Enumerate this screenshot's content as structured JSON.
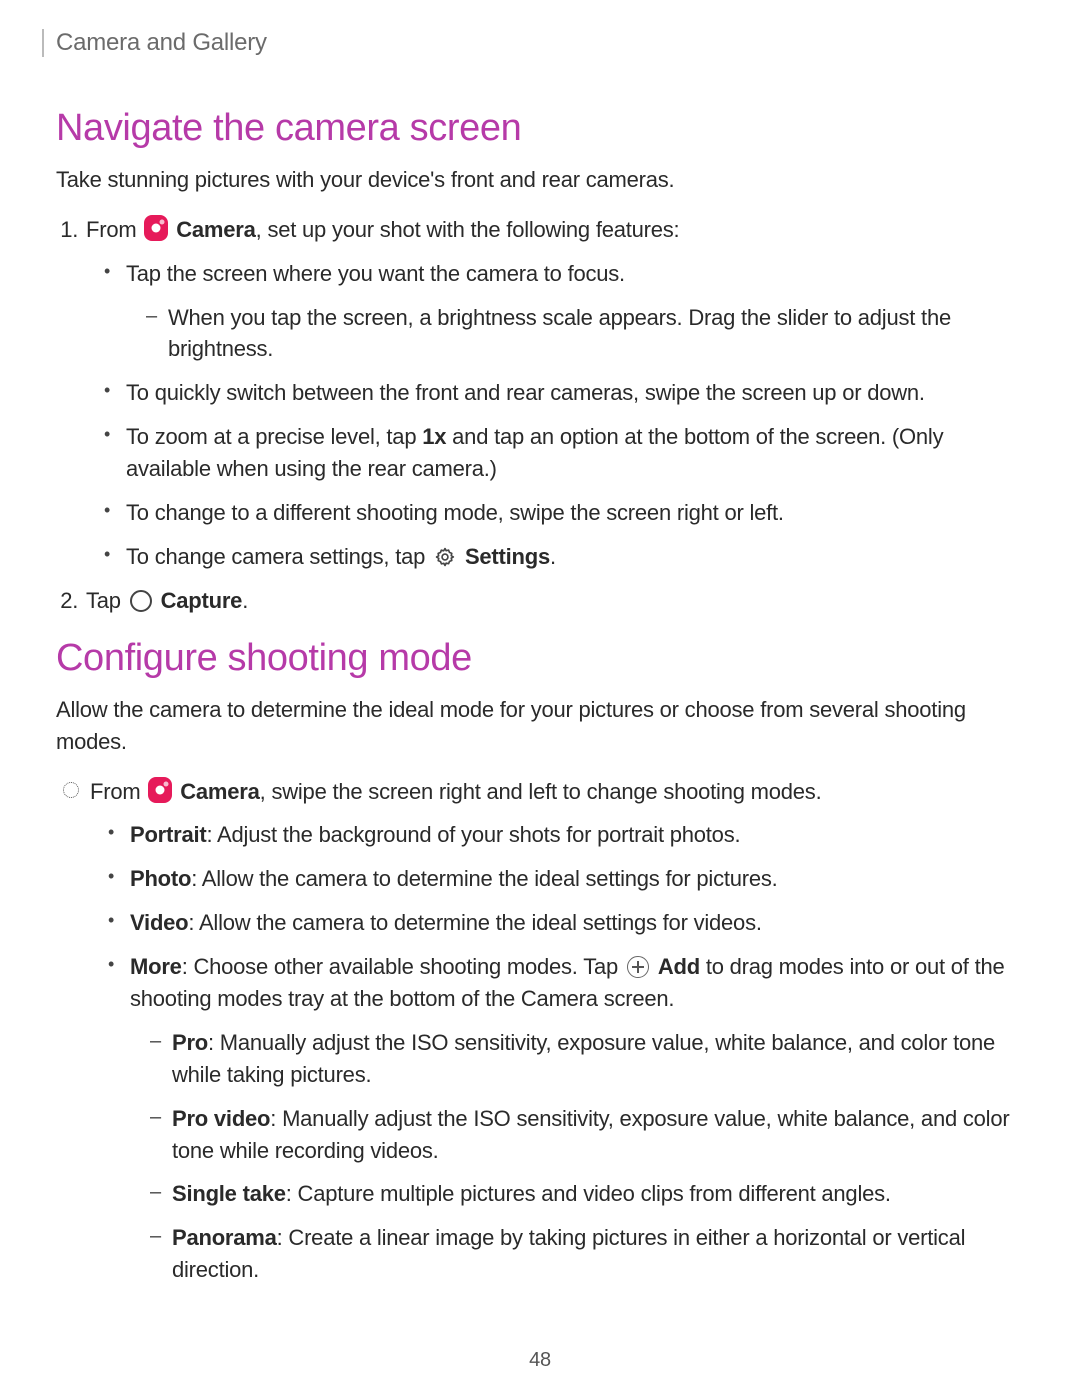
{
  "breadcrumb": "Camera and Gallery",
  "section1": {
    "title": "Navigate the camera screen",
    "intro": "Take stunning pictures with your device's front and rear cameras.",
    "step1": {
      "pre": "From ",
      "camera": "Camera",
      "post": ", set up your shot with the following features:",
      "b1": "Tap the screen where you want the camera to focus.",
      "b1_d1": "When you tap the screen, a brightness scale appears. Drag the slider to adjust the brightness.",
      "b2": "To quickly switch between the front and rear cameras, swipe the screen up or down.",
      "b3_pre": "To zoom at a precise level, tap ",
      "b3_bold": "1x",
      "b3_post": " and tap an option at the bottom of the screen. (Only available when using the rear camera.)",
      "b4": "To change to a different shooting mode, swipe the screen right or left.",
      "b5_pre": "To change camera settings, tap ",
      "b5_bold": "Settings",
      "b5_post": "."
    },
    "step2": {
      "pre": "Tap ",
      "bold": "Capture",
      "post": "."
    }
  },
  "section2": {
    "title": "Configure shooting mode",
    "intro": "Allow the camera to determine the ideal mode for your pictures or choose from several shooting modes.",
    "lead": {
      "pre": "From ",
      "camera": "Camera",
      "post": ", swipe the screen right and left to change shooting modes."
    },
    "modes": {
      "portrait_label": "Portrait",
      "portrait_desc": ": Adjust the background of your shots for portrait photos.",
      "photo_label": "Photo",
      "photo_desc": ": Allow the camera to determine the ideal settings for pictures.",
      "video_label": "Video",
      "video_desc": ": Allow the camera to determine the ideal settings for videos.",
      "more_label": "More",
      "more_desc_pre": ": Choose other available shooting modes. Tap ",
      "more_add": "Add",
      "more_desc_post": " to drag modes into or out of the shooting modes tray at the bottom of the Camera screen.",
      "pro_label": "Pro",
      "pro_desc": ": Manually adjust the ISO sensitivity, exposure value, white balance, and color tone while taking pictures.",
      "provideo_label": "Pro video",
      "provideo_desc": ": Manually adjust the ISO sensitivity, exposure value, white balance, and color tone while recording videos.",
      "single_label": "Single take",
      "single_desc": ": Capture multiple pictures and video clips from different angles.",
      "pano_label": "Panorama",
      "pano_desc": ": Create a linear image by taking pictures in either a horizontal or vertical direction."
    }
  },
  "page_number": "48"
}
